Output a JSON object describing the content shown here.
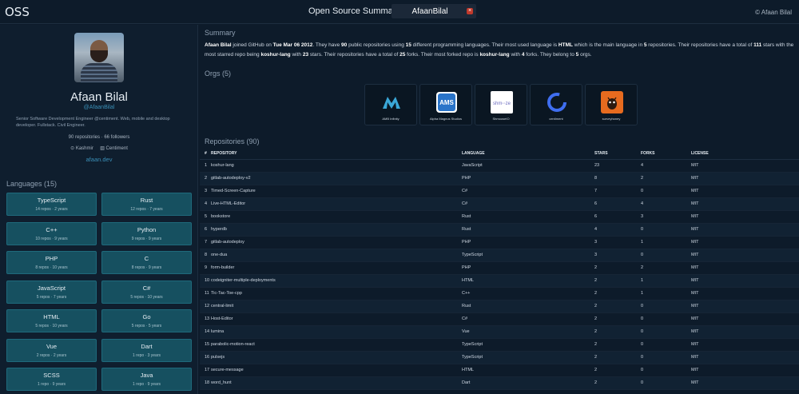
{
  "header": {
    "brand": "OSS",
    "search_label": "Open Source Summary of",
    "search_value": "AfaanBilal",
    "copyright": "© Afaan Bilal"
  },
  "profile": {
    "name": "Afaan Bilal",
    "handle": "@AfaanBilal",
    "bio": "Senior Software Development Engineer @centiment. Web, mobile and desktop developer. Fullstack. Civil Engineer.",
    "repositories": "90 repositories",
    "followers": "66 followers",
    "location": "Kashmir",
    "company": "Centiment",
    "website": "afaan.dev"
  },
  "languages": {
    "heading": "Languages (15)",
    "items": [
      {
        "name": "TypeScript",
        "repos": "14 repos",
        "years": "2 years"
      },
      {
        "name": "Rust",
        "repos": "12 repos",
        "years": "7 years"
      },
      {
        "name": "C++",
        "repos": "10 repos",
        "years": "9 years"
      },
      {
        "name": "Python",
        "repos": "9 repos",
        "years": "9 years"
      },
      {
        "name": "PHP",
        "repos": "8 repos",
        "years": "10 years"
      },
      {
        "name": "C",
        "repos": "8 repos",
        "years": "9 years"
      },
      {
        "name": "JavaScript",
        "repos": "5 repos",
        "years": "7 years"
      },
      {
        "name": "C#",
        "repos": "5 repos",
        "years": "10 years"
      },
      {
        "name": "HTML",
        "repos": "5 repos",
        "years": "10 years"
      },
      {
        "name": "Go",
        "repos": "5 repos",
        "years": "5 years"
      },
      {
        "name": "Vue",
        "repos": "2 repos",
        "years": "2 years"
      },
      {
        "name": "Dart",
        "repos": "1 repo",
        "years": "3 years"
      },
      {
        "name": "SCSS",
        "repos": "1 repo",
        "years": "9 years"
      },
      {
        "name": "Java",
        "repos": "1 repo",
        "years": "9 years"
      }
    ]
  },
  "summary": {
    "heading": "Summary",
    "parts": [
      {
        "t": "Afaan Bilal",
        "b": true
      },
      {
        "t": " joined GitHub on ",
        "b": false
      },
      {
        "t": "Tue Mar 06 2012",
        "b": true
      },
      {
        "t": ". They have ",
        "b": false
      },
      {
        "t": "90",
        "b": true
      },
      {
        "t": " public repositories using ",
        "b": false
      },
      {
        "t": "15",
        "b": true
      },
      {
        "t": " different programming languages. Their most used language is ",
        "b": false
      },
      {
        "t": "HTML",
        "b": true
      },
      {
        "t": " which is the main language in ",
        "b": false
      },
      {
        "t": "5",
        "b": true
      },
      {
        "t": " repositories. Their repositories have a total of ",
        "b": false
      },
      {
        "t": "111",
        "b": true
      },
      {
        "t": " stars with the most starred repo being ",
        "b": false
      },
      {
        "t": "koshur-lang",
        "b": true
      },
      {
        "t": " with ",
        "b": false
      },
      {
        "t": "23",
        "b": true
      },
      {
        "t": " stars. Their repositories have a total of ",
        "b": false
      },
      {
        "t": "25",
        "b": true
      },
      {
        "t": " forks. Their most forked repo is ",
        "b": false
      },
      {
        "t": "koshur-lang",
        "b": true
      },
      {
        "t": " with ",
        "b": false
      },
      {
        "t": "4",
        "b": true
      },
      {
        "t": " forks. They belong to ",
        "b": false
      },
      {
        "t": "5",
        "b": true
      },
      {
        "t": " orgs.",
        "b": false
      }
    ]
  },
  "orgs": {
    "heading": "Orgs (5)",
    "items": [
      {
        "name": "AMB Infinity",
        "logo": "amb-logo-icon",
        "logo_text": "",
        "color": "#3aa8d8"
      },
      {
        "name": "Alpha Magnus Studios",
        "logo": "ams-logo-icon",
        "logo_text": "AMS",
        "color": "#2a74c9"
      },
      {
        "name": "ShmooseIO",
        "logo": "shmooze-logo-icon",
        "logo_text": "shm◦◦ze",
        "color": "#6c6cc0"
      },
      {
        "name": "centiment",
        "logo": "centiment-logo-icon",
        "logo_text": "",
        "color": "#3f6ef0"
      },
      {
        "name": "surveyhoney",
        "logo": "surveyhoney-logo-icon",
        "logo_text": "",
        "color": "#e76b1f"
      }
    ]
  },
  "repositories": {
    "heading": "Repositories (90)",
    "columns": [
      "#",
      "REPOSITORY",
      "LANGUAGE",
      "STARS",
      "FORKS",
      "LICENSE"
    ],
    "rows": [
      [
        "1",
        "koshur-lang",
        "JavaScript",
        "23",
        "4",
        "MIT"
      ],
      [
        "2",
        "gitlab-autodeploy-v2",
        "PHP",
        "8",
        "2",
        "MIT"
      ],
      [
        "3",
        "Timed-Screen-Capture",
        "C#",
        "7",
        "0",
        "MIT"
      ],
      [
        "4",
        "Live-HTML-Editor",
        "C#",
        "6",
        "4",
        "MIT"
      ],
      [
        "5",
        "bookstore",
        "Rust",
        "6",
        "3",
        "MIT"
      ],
      [
        "6",
        "hyperdb",
        "Rust",
        "4",
        "0",
        "MIT"
      ],
      [
        "7",
        "gitlab-autodeploy",
        "PHP",
        "3",
        "1",
        "MIT"
      ],
      [
        "8",
        "one-dua",
        "TypeScript",
        "3",
        "0",
        "MIT"
      ],
      [
        "9",
        "form-builder",
        "PHP",
        "2",
        "2",
        "MIT"
      ],
      [
        "10",
        "codeigniter-multiple-deployments",
        "HTML",
        "2",
        "1",
        "MIT"
      ],
      [
        "11",
        "Tic-Tac-Toe-cpp",
        "C++",
        "2",
        "1",
        "MIT"
      ],
      [
        "12",
        "central-limit",
        "Rust",
        "2",
        "0",
        "MIT"
      ],
      [
        "13",
        "Host-Editor",
        "C#",
        "2",
        "0",
        "MIT"
      ],
      [
        "14",
        "lumina",
        "Vue",
        "2",
        "0",
        "MIT"
      ],
      [
        "15",
        "parabolic-motion-react",
        "TypeScript",
        "2",
        "0",
        "MIT"
      ],
      [
        "16",
        "pulsejs",
        "TypeScript",
        "2",
        "0",
        "MIT"
      ],
      [
        "17",
        "secure-message",
        "HTML",
        "2",
        "0",
        "MIT"
      ],
      [
        "18",
        "word_hunt",
        "Dart",
        "2",
        "0",
        "MIT"
      ]
    ]
  }
}
